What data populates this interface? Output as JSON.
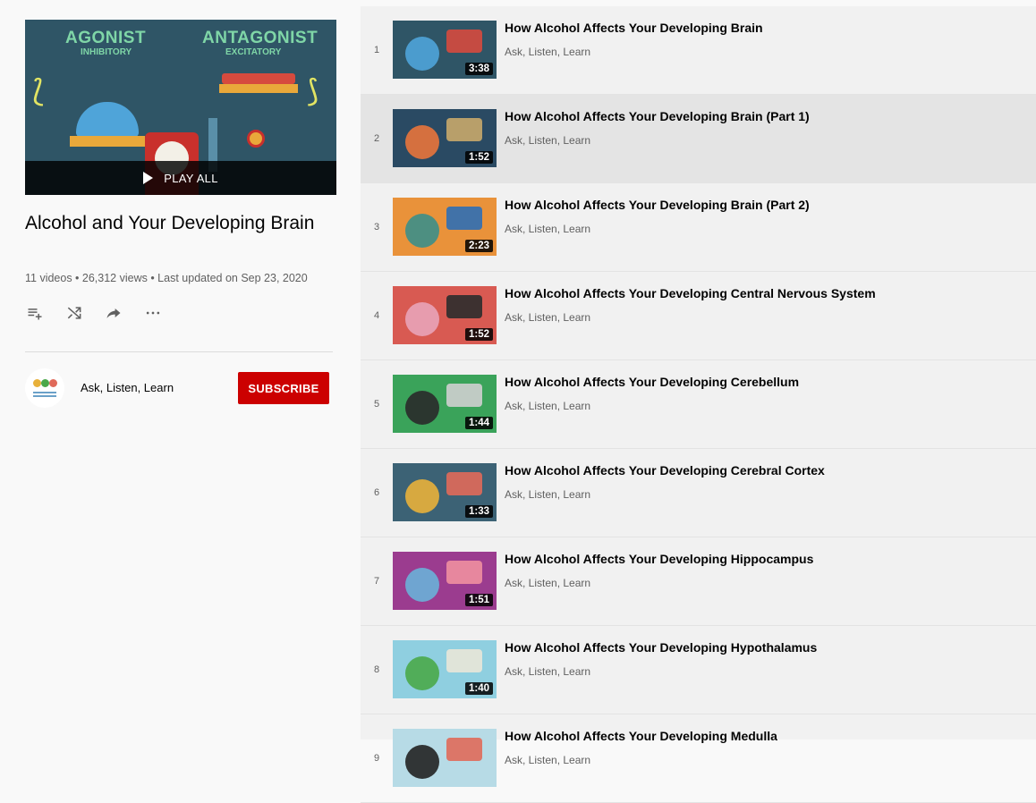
{
  "hero": {
    "overlay_text": {
      "agonist": "AGONIST",
      "inhibitory": "INHIBITORY",
      "antagonist": "ANTAGONIST",
      "excitatory": "EXCITATORY"
    },
    "play_all_label": "PLAY ALL",
    "play_icon": "play-icon"
  },
  "playlist": {
    "title": "Alcohol and Your Developing Brain",
    "stats": "11 videos • 26,312 views • Last updated on Sep 23, 2020"
  },
  "actions": [
    {
      "icon": "add-to-queue-icon"
    },
    {
      "icon": "shuffle-icon"
    },
    {
      "icon": "share-icon"
    },
    {
      "icon": "more-icon"
    }
  ],
  "owner": {
    "name": "Ask, Listen, Learn",
    "subscribe_label": "SUBSCRIBE"
  },
  "colors": {
    "subscribe_bg": "#cc0000",
    "active_row_bg": "#e4e4e4",
    "list_bg": "#f1f1f1"
  },
  "videos": [
    {
      "index": "1",
      "title": "How Alcohol Affects Your Developing Brain",
      "channel": "Ask, Listen, Learn",
      "duration": "3:38",
      "thumb_bg": "#2f5566",
      "accent1": "#4fa4d9",
      "accent2": "#d64a3e"
    },
    {
      "index": "2",
      "title": "How Alcohol Affects Your Developing Brain (Part 1)",
      "channel": "Ask, Listen, Learn",
      "duration": "1:52",
      "thumb_bg": "#2a4a63",
      "accent1": "#e8743b",
      "accent2": "#c8a86a"
    },
    {
      "index": "3",
      "title": "How Alcohol Affects Your Developing Brain (Part 2)",
      "channel": "Ask, Listen, Learn",
      "duration": "2:23",
      "thumb_bg": "#e9923a",
      "accent1": "#3c8f8a",
      "accent2": "#2f6fb5"
    },
    {
      "index": "4",
      "title": "How Alcohol Affects Your Developing Central Nervous System",
      "channel": "Ask, Listen, Learn",
      "duration": "1:52",
      "thumb_bg": "#d85a52",
      "accent1": "#e9a3b8",
      "accent2": "#2c2c2c"
    },
    {
      "index": "5",
      "title": "How Alcohol Affects Your Developing Cerebellum",
      "channel": "Ask, Listen, Learn",
      "duration": "1:44",
      "thumb_bg": "#3aa35a",
      "accent1": "#2a2a2a",
      "accent2": "#cfcfcf"
    },
    {
      "index": "6",
      "title": "How Alcohol Affects Your Developing Cerebral Cortex",
      "channel": "Ask, Listen, Learn",
      "duration": "1:33",
      "thumb_bg": "#3c6275",
      "accent1": "#e8b13b",
      "accent2": "#e06a5a"
    },
    {
      "index": "7",
      "title": "How Alcohol Affects Your Developing Hippocampus",
      "channel": "Ask, Listen, Learn",
      "duration": "1:51",
      "thumb_bg": "#9b3c8f",
      "accent1": "#6ab0d8",
      "accent2": "#f08fa0"
    },
    {
      "index": "8",
      "title": "How Alcohol Affects Your Developing Hypothalamus",
      "channel": "Ask, Listen, Learn",
      "duration": "1:40",
      "thumb_bg": "#8fcfe0",
      "accent1": "#4aa84a",
      "accent2": "#e9e6d8"
    },
    {
      "index": "9",
      "title": "How Alcohol Affects Your Developing Medulla",
      "channel": "Ask, Listen, Learn",
      "duration": "",
      "thumb_bg": "#b7dbe6",
      "accent1": "#222222",
      "accent2": "#e06a5a"
    }
  ],
  "active_index": 1
}
